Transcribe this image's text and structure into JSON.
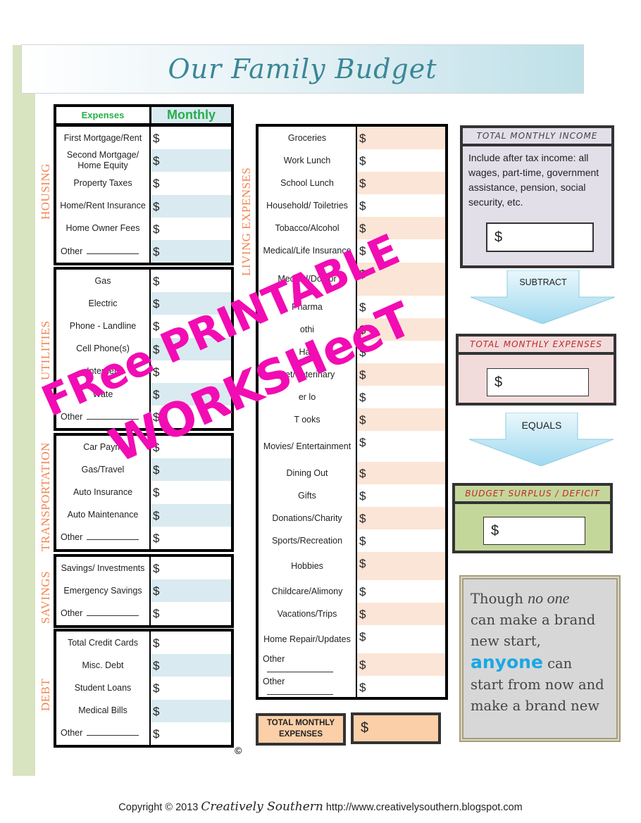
{
  "title": "Our Family Budget",
  "header": {
    "expenses_label": "Expenses",
    "monthly_label": "Monthly"
  },
  "currency_symbol": "$",
  "sections": {
    "housing": {
      "label": "HOUSING",
      "items": [
        "First Mortgage/Rent",
        "Second Mortgage/ Home Equity",
        "Property Taxes",
        "Home/Rent Insurance",
        "Home Owner Fees",
        "Other"
      ]
    },
    "utilities": {
      "label": "UTILITIES",
      "items": [
        "Gas",
        "Electric",
        "Phone - Landline",
        "Cell Phone(s)",
        "Internet/",
        "Wate",
        "Other"
      ]
    },
    "transportation": {
      "label": "TRANSPORTATION",
      "items": [
        "Car Paym",
        "Gas/Travel",
        "Auto Insurance",
        "Auto Maintenance",
        "Other"
      ]
    },
    "savings": {
      "label": "SAVINGS",
      "items": [
        "Savings/ Investments",
        "Emergency Savings",
        "Other"
      ]
    },
    "debt": {
      "label": "DEBT",
      "items": [
        "Total Credit Cards",
        "Misc. Debt",
        "Student Loans",
        "Medical Bills",
        "Other"
      ]
    },
    "living": {
      "label": "LIVING EXPENSES",
      "items": [
        "Groceries",
        "Work Lunch",
        "School Lunch",
        "Household/ Toiletries",
        "Tobacco/Alcohol",
        "Medical/Life Insurance",
        "Medical/Doctor",
        "Pharma",
        "othi",
        "Hair",
        "Pet/Veterinary",
        "er lo",
        "T ooks",
        "Movies/ Entertainment",
        "Dining Out",
        "Gifts",
        "Donations/Charity",
        "Sports/Recreation",
        "Hobbies",
        "Childcare/Alimony",
        "Vacations/Trips",
        "Home Repair/Updates",
        "Other",
        "Other"
      ]
    }
  },
  "total_expenses_box": {
    "label": "TOTAL MONTHLY EXPENSES",
    "value": "$"
  },
  "income_box": {
    "title": "TOTAL MONTHLY INCOME",
    "description": "Include after tax income: all wages, part-time, government assistance, pension, social security, etc.",
    "value": "$",
    "color": "#e3dfe9"
  },
  "arrow_subtract": "SUBTRACT",
  "expenses_summary_box": {
    "title": "TOTAL MONTHLY EXPENSES",
    "value": "$",
    "color": "#f2dcdb"
  },
  "arrow_equals": "EQUALS",
  "surplus_box": {
    "title": "BUDGET SURPLUS / DEFICIT",
    "value": "$",
    "color": "#c4d79b"
  },
  "quote": {
    "part1": "Though ",
    "part2": "no one",
    "part3": "can make a brand new start,",
    "part4": "anyone",
    "part5": " can start from now and make a brand new"
  },
  "copyright_mark": "©",
  "footer": {
    "prefix": "Copyright © 2013 ",
    "brand": "Creatively Southern",
    "url": " http://www.creativelysouthern.blogspot.com"
  },
  "watermark": {
    "line1": "FRee PRINTABLE",
    "line2": "WORKSHeeT",
    "color": "#f20cb3"
  }
}
